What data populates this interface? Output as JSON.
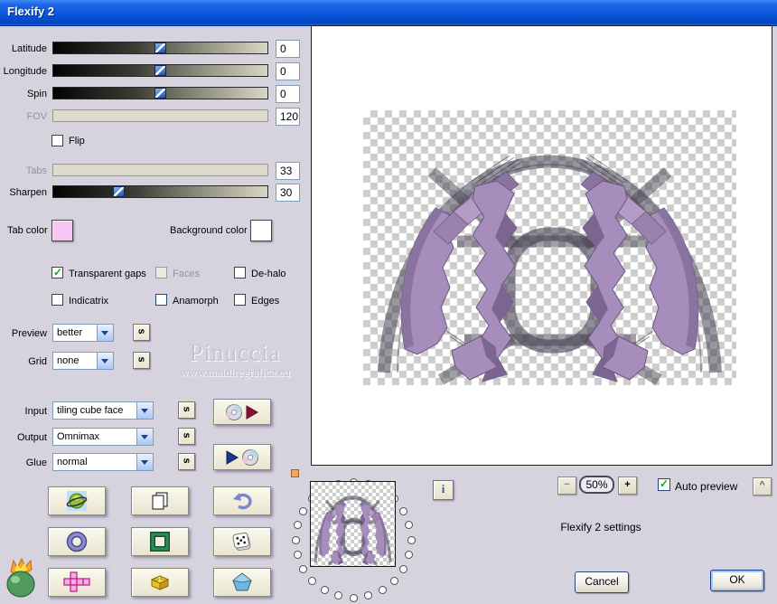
{
  "window": {
    "title": "Flexify 2"
  },
  "colors": {
    "titlebar": "#0a57dd",
    "dialog_bg": "#d6d3df",
    "tab_color_swatch": "#f8c6f4",
    "background_color_swatch": "#ffffff",
    "check_green": "#18a518"
  },
  "sliders": [
    {
      "label": "Latitude",
      "value": "0",
      "enabled": true
    },
    {
      "label": "Longitude",
      "value": "0",
      "enabled": true
    },
    {
      "label": "Spin",
      "value": "0",
      "enabled": true
    },
    {
      "label": "FOV",
      "value": "120",
      "enabled": false
    },
    {
      "label": "Tabs",
      "value": "33",
      "enabled": false
    },
    {
      "label": "Sharpen",
      "value": "30",
      "enabled": true
    }
  ],
  "flip": {
    "label": "Flip",
    "checked": false
  },
  "color_pickers": {
    "tab": {
      "label": "Tab color"
    },
    "background": {
      "label": "Background color"
    }
  },
  "options": [
    {
      "label": "Transparent gaps",
      "checked": true,
      "enabled": true
    },
    {
      "label": "Faces",
      "checked": false,
      "enabled": false
    },
    {
      "label": "De-halo",
      "checked": false,
      "enabled": true
    },
    {
      "label": "Indicatrix",
      "checked": false,
      "enabled": true
    },
    {
      "label": "Anamorph",
      "checked": false,
      "enabled": true
    },
    {
      "label": "Edges",
      "checked": false,
      "enabled": true
    }
  ],
  "dropdowns": {
    "preview": {
      "label": "Preview",
      "value": "better"
    },
    "grid": {
      "label": "Grid",
      "value": "none"
    },
    "input": {
      "label": "Input",
      "value": "tiling cube face"
    },
    "output": {
      "label": "Output",
      "value": "Omnimax"
    },
    "glue": {
      "label": "Glue",
      "value": "normal"
    }
  },
  "shuffle_button_label": "s",
  "watermark": {
    "line1": "Pinuccia",
    "line2": "www.maidiregrafica.eu"
  },
  "preview_panel": {
    "zoom_out": "−",
    "zoom_level": "50%",
    "zoom_in": "+",
    "auto_preview": {
      "label": "Auto preview",
      "checked": true
    },
    "collapse": "^",
    "info": "i"
  },
  "footer": {
    "settings_caption": "Flexify 2 settings",
    "cancel": "Cancel",
    "ok": "OK"
  },
  "icons": {
    "shuffle": "rotated-s-glyph",
    "save_settings": "disc-with-red-arrow-icon",
    "load_settings": "blue-arrow-with-disc-icon",
    "grid_buttons": [
      "planet-icon",
      "copy-pages-icon",
      "undo-arrow-icon",
      "torus-icon",
      "square-ring-icon",
      "dice-icon",
      "cube-net-icon",
      "brick-icon",
      "pentagon-icon"
    ],
    "logo": "flaming-pear-icon",
    "info": "info-icon"
  }
}
